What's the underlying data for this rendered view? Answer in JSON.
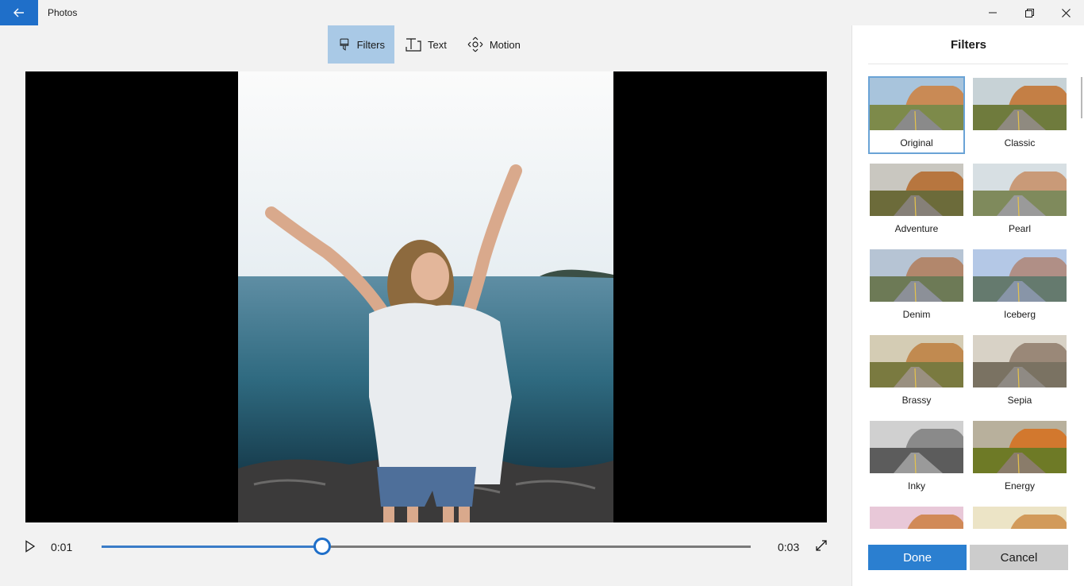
{
  "window": {
    "title": "Photos"
  },
  "toolbar": {
    "items": [
      {
        "label": "Filters",
        "icon": "brush-icon",
        "active": true
      },
      {
        "label": "Text",
        "icon": "text-icon",
        "active": false
      },
      {
        "label": "Motion",
        "icon": "motion-icon",
        "active": false
      }
    ]
  },
  "playback": {
    "current_time": "0:01",
    "total_time": "0:03",
    "progress": 0.34
  },
  "panel": {
    "title": "Filters",
    "filters": [
      {
        "label": "Original",
        "selected": true,
        "tone": "original"
      },
      {
        "label": "Classic",
        "selected": false,
        "tone": "classic"
      },
      {
        "label": "Adventure",
        "selected": false,
        "tone": "adventure"
      },
      {
        "label": "Pearl",
        "selected": false,
        "tone": "pearl"
      },
      {
        "label": "Denim",
        "selected": false,
        "tone": "denim"
      },
      {
        "label": "Iceberg",
        "selected": false,
        "tone": "iceberg"
      },
      {
        "label": "Brassy",
        "selected": false,
        "tone": "brassy"
      },
      {
        "label": "Sepia",
        "selected": false,
        "tone": "sepia"
      },
      {
        "label": "Inky",
        "selected": false,
        "tone": "inky"
      },
      {
        "label": "Energy",
        "selected": false,
        "tone": "energy"
      },
      {
        "label": "",
        "selected": false,
        "tone": "partial1"
      },
      {
        "label": "",
        "selected": false,
        "tone": "partial2"
      }
    ],
    "done_label": "Done",
    "cancel_label": "Cancel"
  },
  "colors": {
    "accent": "#2b7fd0",
    "toolbar_active": "#a9c9e6",
    "selected_border": "#6aa3d6"
  }
}
